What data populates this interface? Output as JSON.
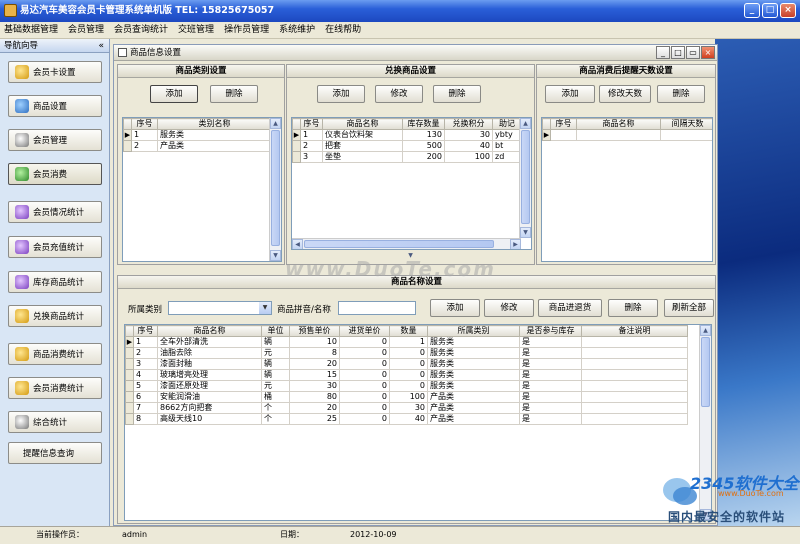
{
  "app": {
    "title": "易达汽车美容会员卡管理系统单机版 TEL: 15825675057"
  },
  "menu": [
    "基础数据管理",
    "会员管理",
    "会员查询统计",
    "交班管理",
    "操作员管理",
    "系统维护",
    "在线帮助"
  ],
  "sidebar": {
    "title": "导航向导",
    "collapse": "«",
    "items": [
      {
        "label": "会员卡设置"
      },
      {
        "label": "商品设置"
      },
      {
        "label": "会员管理"
      },
      {
        "label": "会员消费"
      },
      {
        "label": "会员情况统计"
      },
      {
        "label": "会员充值统计"
      },
      {
        "label": "库存商品统计"
      },
      {
        "label": "兑换商品统计"
      },
      {
        "label": "商品消费统计"
      },
      {
        "label": "会员消费统计"
      },
      {
        "label": "综合统计"
      },
      {
        "label": "提醒信息查询"
      }
    ]
  },
  "child": {
    "title": "商品信息设置"
  },
  "category": {
    "title": "商品类别设置",
    "add": "添加",
    "delete": "删除",
    "headers": [
      "序号",
      "类别名称"
    ],
    "rows": [
      [
        "1",
        "服务类"
      ],
      [
        "2",
        "产品类"
      ]
    ]
  },
  "exchange": {
    "title": "兑换商品设置",
    "add": "添加",
    "edit": "修改",
    "delete": "删除",
    "headers": [
      "序号",
      "商品名称",
      "库存数量",
      "兑换积分",
      "助记"
    ],
    "rows": [
      [
        "1",
        "仪表台饮料架",
        "130",
        "30",
        "ybty"
      ],
      [
        "2",
        "把套",
        "500",
        "40",
        "bt"
      ],
      [
        "3",
        "坐垫",
        "200",
        "100",
        "zd"
      ]
    ]
  },
  "remind": {
    "title": "商品消费后提醒天数设置",
    "add": "添加",
    "edit_days": "修改天数",
    "delete": "删除",
    "headers": [
      "序号",
      "商品名称",
      "间隔天数"
    ]
  },
  "goods": {
    "title": "商品名称设置",
    "category_label": "所属类别",
    "pinyin_label": "商品拼音/名称",
    "add": "添加",
    "edit": "修改",
    "stock_in": "商品进退货",
    "delete": "删除",
    "refresh": "刷新全部",
    "headers": [
      "序号",
      "商品名称",
      "单位",
      "预售单价",
      "进货单价",
      "数量",
      "所属类别",
      "是否参与库存",
      "备注说明"
    ],
    "rows": [
      [
        "1",
        "全车外部清洗",
        "辆",
        "10",
        "0",
        "1",
        "服务类",
        "是",
        ""
      ],
      [
        "2",
        "油脂去除",
        "元",
        "8",
        "0",
        "0",
        "服务类",
        "是",
        ""
      ],
      [
        "3",
        "漆面封釉",
        "辆",
        "20",
        "0",
        "0",
        "服务类",
        "是",
        ""
      ],
      [
        "4",
        "玻璃增亮处理",
        "辆",
        "15",
        "0",
        "0",
        "服务类",
        "是",
        ""
      ],
      [
        "5",
        "漆面还原处理",
        "元",
        "30",
        "0",
        "0",
        "服务类",
        "是",
        ""
      ],
      [
        "6",
        "安能润滑油",
        "桶",
        "80",
        "0",
        "100",
        "产品类",
        "是",
        ""
      ],
      [
        "7",
        "8662方向把套",
        "个",
        "20",
        "0",
        "30",
        "产品类",
        "是",
        ""
      ],
      [
        "8",
        "高级天线10",
        "个",
        "25",
        "0",
        "40",
        "产品类",
        "是",
        ""
      ]
    ]
  },
  "status": {
    "operator_label": "当前操作员：",
    "operator": "admin",
    "date_label": "日期：",
    "date": "2012-10-09"
  },
  "watermarks": {
    "center": "www.DuoTe.com",
    "brand": "2345软件大全",
    "brand_url": "www.DuoTe.com",
    "slogan": "国内最安全的软件站"
  }
}
